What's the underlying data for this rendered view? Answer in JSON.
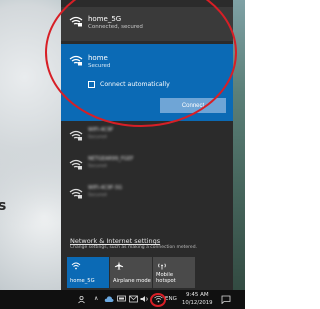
{
  "networks": {
    "connected": {
      "name": "home_5G",
      "status": "Connected, secured"
    },
    "selected": {
      "name": "home",
      "status": "Secured",
      "auto_connect_label": "Connect automatically",
      "auto_connect_checked": false,
      "connect_label": "Connect"
    },
    "others": [
      {
        "name": "WIFI-4C9F",
        "status": "Secured"
      },
      {
        "name": "NETGEAR99_FGEF",
        "status": "Secured"
      },
      {
        "name": "WIFI-4C9F-5G",
        "status": "Secured"
      }
    ]
  },
  "settings": {
    "link": "Network & Internet settings",
    "description": "Change settings, such as making a connection metered."
  },
  "quick_actions": [
    {
      "label": "home_5G",
      "icon": "wifi-icon",
      "active": true
    },
    {
      "label": "Airplane mode",
      "icon": "airplane-icon",
      "active": false
    },
    {
      "label": "Mobile hotspot",
      "icon": "hotspot-icon",
      "active": false
    }
  ],
  "taskbar": {
    "language": "ENG",
    "time": "9:45 AM",
    "date": "10/12/2019"
  },
  "colors": {
    "accent": "#0b6ab5",
    "flyout_bg": "#2b2b2b",
    "annotation": "#d71f26"
  }
}
